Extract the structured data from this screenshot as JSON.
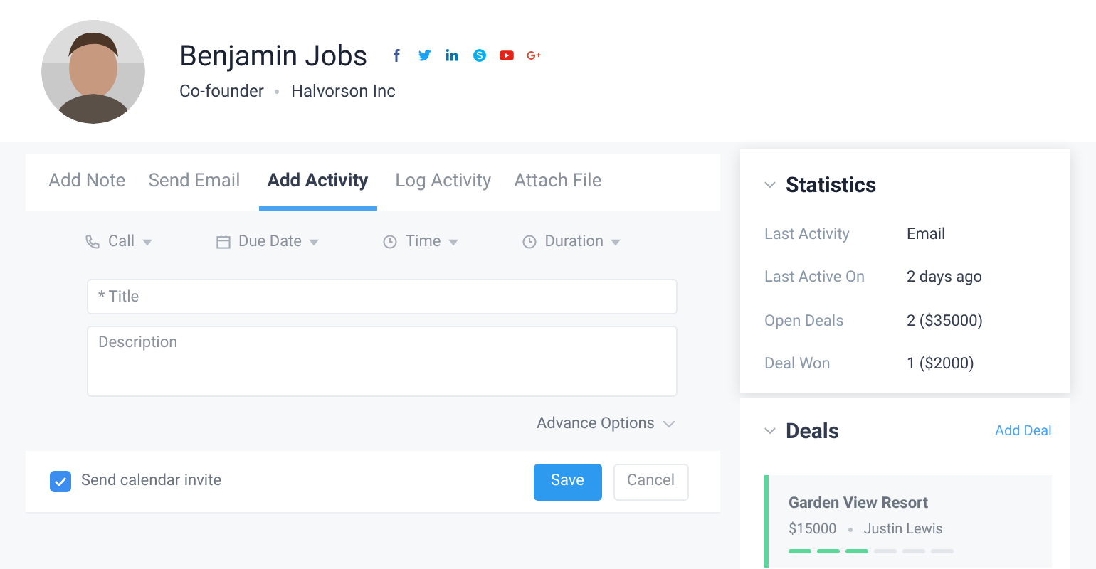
{
  "profile": {
    "name": "Benjamin Jobs",
    "role": "Co-founder",
    "company": "Halvorson Inc",
    "social": [
      {
        "kind": "facebook",
        "color": "#3b5998"
      },
      {
        "kind": "twitter",
        "color": "#1da1f2"
      },
      {
        "kind": "linkedin",
        "color": "#0077b5"
      },
      {
        "kind": "skype",
        "color": "#00aff0"
      },
      {
        "kind": "youtube",
        "color": "#e62117"
      },
      {
        "kind": "googleplus",
        "color": "#dd4b39"
      }
    ]
  },
  "tabs": [
    {
      "label": "Add Note",
      "selected": false
    },
    {
      "label": "Send Email",
      "selected": false
    },
    {
      "label": "Add Activity",
      "selected": true
    },
    {
      "label": "Log Activity",
      "selected": false
    },
    {
      "label": "Attach File",
      "selected": false
    }
  ],
  "activity_options": [
    {
      "kind": "phone",
      "label": "Call"
    },
    {
      "kind": "calendar",
      "label": "Due Date"
    },
    {
      "kind": "clock",
      "label": "Time"
    },
    {
      "kind": "clock",
      "label": "Duration"
    }
  ],
  "title_field": {
    "placeholder": "* Title"
  },
  "description_field": {
    "placeholder": "Description"
  },
  "advance_options": "Advance Options",
  "send_invite": {
    "label": "Send calendar invite",
    "checked": true
  },
  "buttons": {
    "save": "Save",
    "cancel": "Cancel"
  },
  "statistics": {
    "title": "Statistics",
    "expanded": true,
    "rows": [
      {
        "label": "Last Activity",
        "value": "Email"
      },
      {
        "label": "Last Active On",
        "value": "2 days ago"
      },
      {
        "label": "Open Deals",
        "value": "2 ($35000)"
      },
      {
        "label": "Deal Won",
        "value": "1 ($2000)"
      }
    ]
  },
  "deals": {
    "title": "Deals",
    "expanded": true,
    "add_label": "Add Deal",
    "items": [
      {
        "name": "Garden View Resort",
        "amount": "$15000",
        "owner": "Justin Lewis",
        "stages": [
          {
            "done": true
          },
          {
            "done": true
          },
          {
            "done": true
          },
          {
            "done": false
          },
          {
            "done": false
          },
          {
            "done": false
          }
        ]
      }
    ]
  }
}
